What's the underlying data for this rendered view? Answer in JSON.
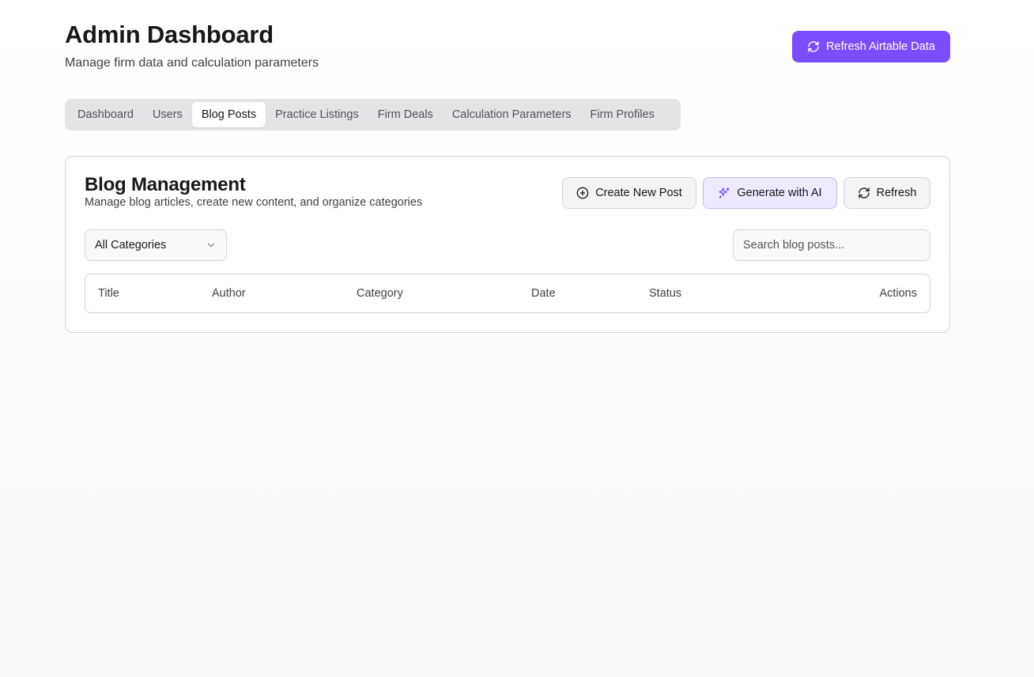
{
  "header": {
    "title": "Admin Dashboard",
    "subtitle": "Manage firm data and calculation parameters",
    "refresh_button": "Refresh Airtable Data"
  },
  "tabs": [
    {
      "label": "Dashboard",
      "active": false
    },
    {
      "label": "Users",
      "active": false
    },
    {
      "label": "Blog Posts",
      "active": true
    },
    {
      "label": "Practice Listings",
      "active": false
    },
    {
      "label": "Firm Deals",
      "active": false
    },
    {
      "label": "Calculation Parameters",
      "active": false
    },
    {
      "label": "Firm Profiles",
      "active": false
    }
  ],
  "blog": {
    "title": "Blog Management",
    "description": "Manage blog articles, create new content, and organize categories",
    "actions": {
      "create": "Create New Post",
      "generate": "Generate with AI",
      "refresh": "Refresh"
    },
    "category_filter": "All Categories",
    "search": {
      "value": "",
      "placeholder": "Search blog posts..."
    },
    "table": {
      "columns": [
        "Title",
        "Author",
        "Category",
        "Date",
        "Status",
        "Actions"
      ],
      "rows": []
    }
  },
  "colors": {
    "accent": "#7c4dff",
    "ai_button_bg": "#ede9fe"
  },
  "icons": {
    "refresh": "refresh-icon",
    "create": "plus-circle-icon",
    "generate": "sparkles-icon",
    "select": "chevron-down-icon"
  }
}
